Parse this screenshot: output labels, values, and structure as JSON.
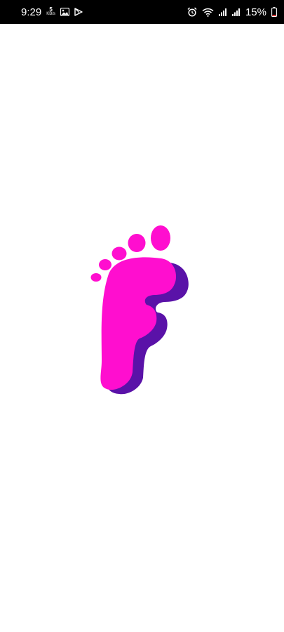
{
  "status_bar": {
    "time": "9:29",
    "net_speed_value": "5",
    "net_speed_unit": "KB/s",
    "battery_percent": "15%",
    "icons": [
      "image-notification-icon",
      "play-store-icon",
      "alarm-icon",
      "wifi-icon",
      "signal-icon",
      "signal-icon-2",
      "battery-icon"
    ]
  },
  "splash": {
    "logo_letter": "F",
    "colors": {
      "primary": "#FF0ECF",
      "shadow": "#5A12A8",
      "background": "#FFFFFF"
    }
  }
}
